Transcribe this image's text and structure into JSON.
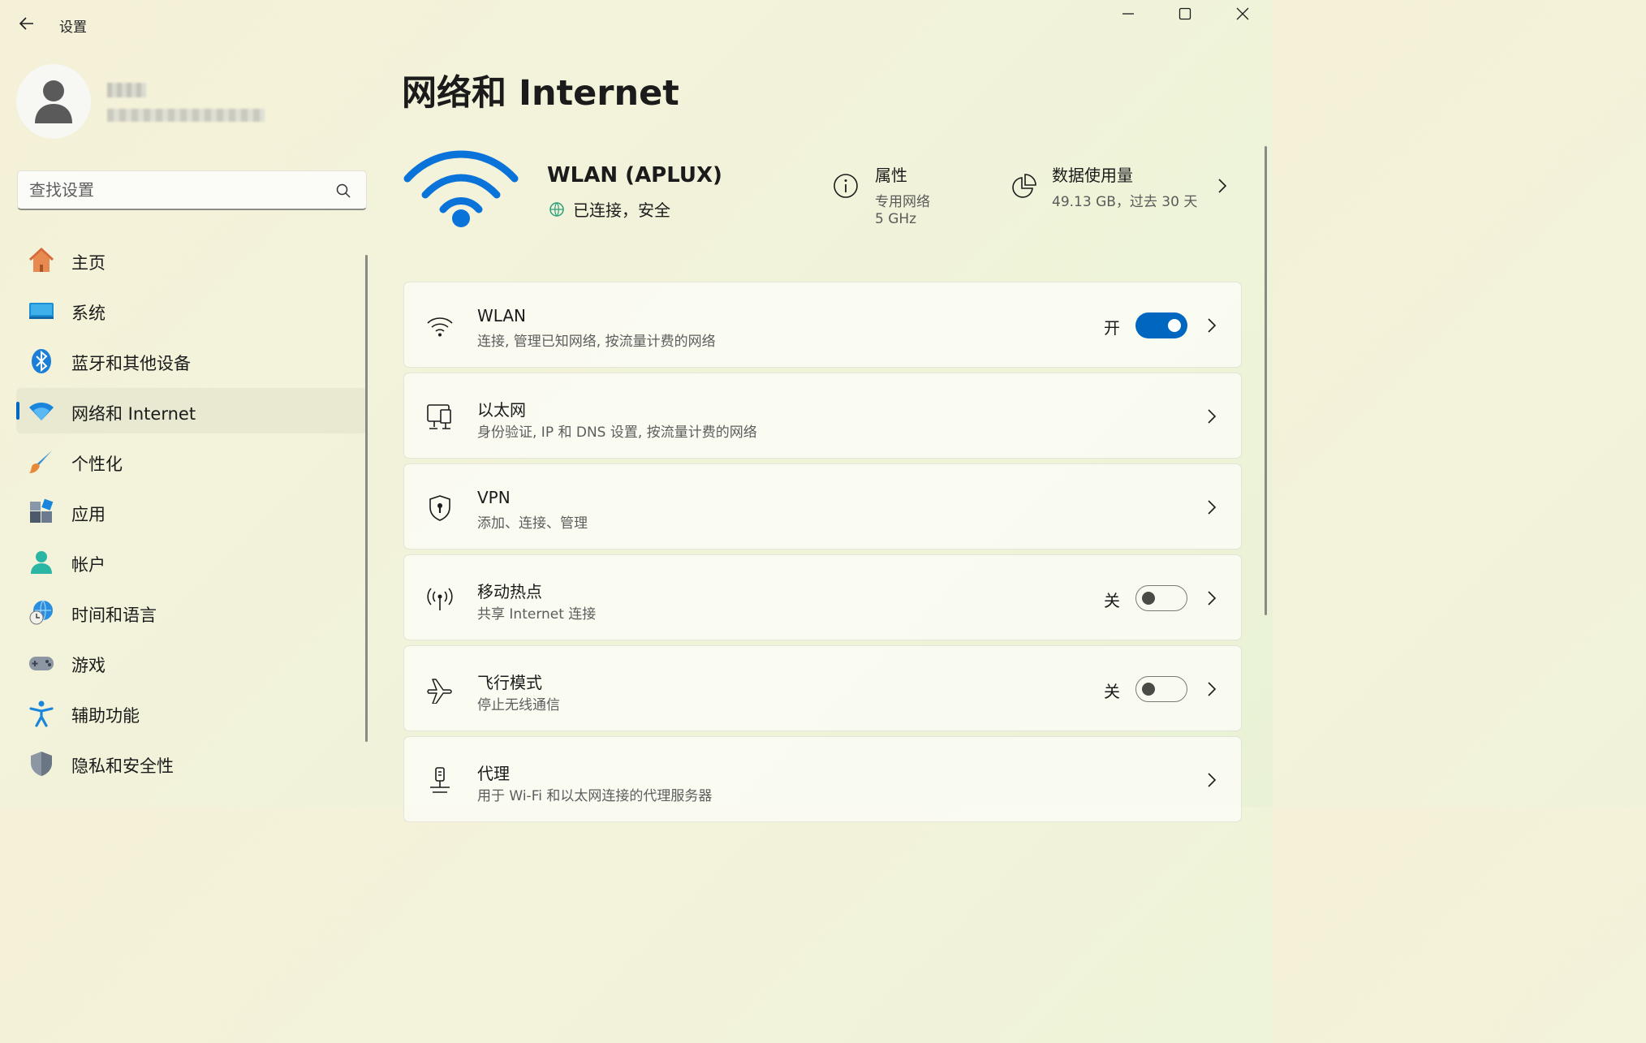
{
  "window": {
    "title": "设置"
  },
  "user": {
    "name": "",
    "email": ""
  },
  "search": {
    "placeholder": "查找设置"
  },
  "nav": [
    {
      "label": "主页",
      "icon": "home-icon"
    },
    {
      "label": "系统",
      "icon": "system-icon"
    },
    {
      "label": "蓝牙和其他设备",
      "icon": "bluetooth-icon"
    },
    {
      "label": "网络和 Internet",
      "icon": "network-icon",
      "selected": true
    },
    {
      "label": "个性化",
      "icon": "brush-icon"
    },
    {
      "label": "应用",
      "icon": "apps-icon"
    },
    {
      "label": "帐户",
      "icon": "account-icon"
    },
    {
      "label": "时间和语言",
      "icon": "time-language-icon"
    },
    {
      "label": "游戏",
      "icon": "gaming-icon"
    },
    {
      "label": "辅助功能",
      "icon": "accessibility-icon"
    },
    {
      "label": "隐私和安全性",
      "icon": "privacy-shield-icon"
    }
  ],
  "page": {
    "title": "网络和 Internet"
  },
  "connection": {
    "name": "WLAN (APLUX)",
    "status": "已连接，安全",
    "properties": {
      "title": "属性",
      "line1": "专用网络",
      "line2": "5 GHz"
    },
    "usage": {
      "title": "数据使用量",
      "value": "49.13 GB，过去 30 天"
    }
  },
  "cards": [
    {
      "title": "WLAN",
      "desc": "连接, 管理已知网络, 按流量计费的网络",
      "icon": "wifi-icon",
      "toggle": true,
      "state": "开",
      "on": true
    },
    {
      "title": "以太网",
      "desc": "身份验证, IP 和 DNS 设置, 按流量计费的网络",
      "icon": "ethernet-icon",
      "toggle": false
    },
    {
      "title": "VPN",
      "desc": "添加、连接、管理",
      "icon": "vpn-shield-icon",
      "toggle": false
    },
    {
      "title": "移动热点",
      "desc": "共享 Internet 连接",
      "icon": "hotspot-icon",
      "toggle": true,
      "state": "关",
      "on": false
    },
    {
      "title": "飞行模式",
      "desc": "停止无线通信",
      "icon": "airplane-icon",
      "toggle": true,
      "state": "关",
      "on": false
    },
    {
      "title": "代理",
      "desc": "用于 Wi-Fi 和以太网连接的代理服务器",
      "icon": "proxy-icon",
      "toggle": false
    }
  ],
  "colors": {
    "accent": "#0067c0",
    "hero_wifi": "#0a73d9"
  }
}
